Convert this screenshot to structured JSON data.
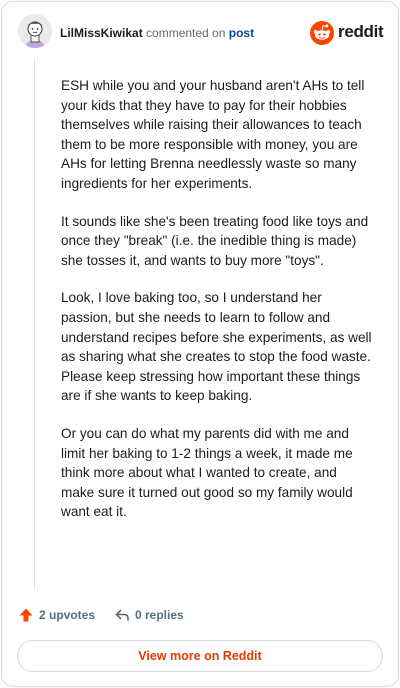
{
  "header": {
    "username": "LilMissKiwikat",
    "action_text": "commented on",
    "post_link": "post",
    "brand": "reddit",
    "brand_color": "#ff4500"
  },
  "comment": {
    "paragraphs": [
      "ESH while you and your husband aren't AHs to tell your kids that they have to pay for their hobbies themselves while raising their allowances to teach them to be more responsible with money, you are AHs for letting Brenna needlessly waste so many ingredients for her experiments.",
      "It sounds like she's been treating food like toys and once they \"break\" (i.e. the inedible thing is made) she tosses it, and wants to buy more \"toys\".",
      "Look, I love baking too, so I understand her passion, but she needs to learn to follow and understand recipes before she experiments, as well as sharing what she creates to stop the food waste. Please keep stressing how important these things are if she wants to keep baking.",
      "Or you can do what my parents did with me and limit her baking to 1-2 things a week, it made me think more about what I wanted to create, and make sure it turned out good so my family would want eat it."
    ]
  },
  "actions": {
    "upvotes_label": "2 upvotes",
    "replies_label": "0 replies",
    "upvote_icon": "arrow-up-icon",
    "reply_icon": "reply-arrow-icon"
  },
  "footer": {
    "view_more_label": "View more on Reddit"
  }
}
